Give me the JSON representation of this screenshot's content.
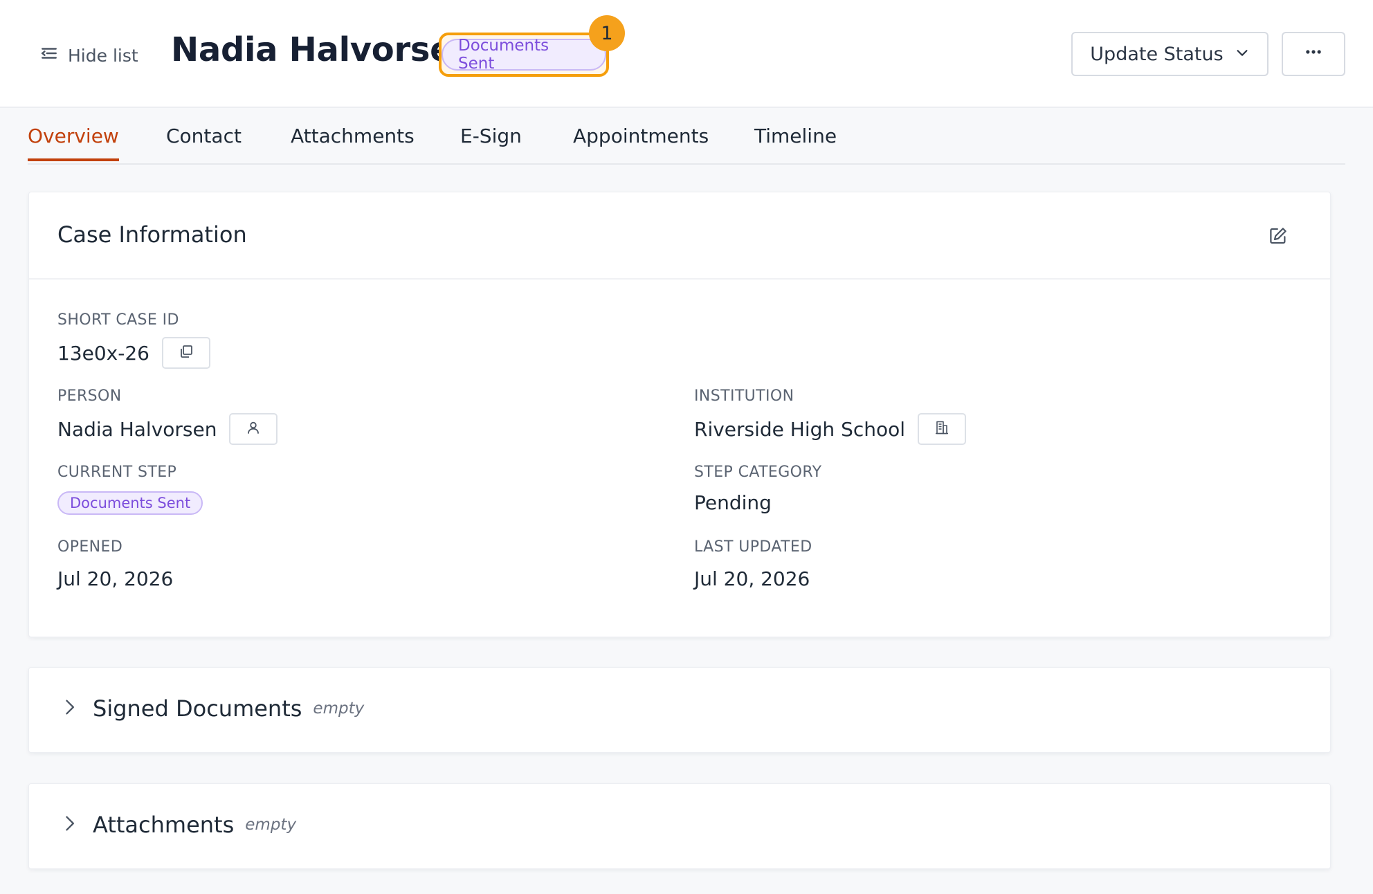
{
  "header": {
    "hide_list_label": "Hide list",
    "title": "Nadia Halvorsen",
    "status": "Documents Sent",
    "notification_count": "1",
    "update_status_label": "Update Status"
  },
  "tabs": [
    {
      "label": "Overview",
      "active": true
    },
    {
      "label": "Contact"
    },
    {
      "label": "Attachments"
    },
    {
      "label": "E-Sign"
    },
    {
      "label": "Appointments"
    },
    {
      "label": "Timeline"
    }
  ],
  "case_info": {
    "title": "Case Information",
    "short_case_id": {
      "label": "SHORT CASE ID",
      "value": "13e0x-26"
    },
    "person": {
      "label": "PERSON",
      "value": "Nadia Halvorsen"
    },
    "institution": {
      "label": "INSTITUTION",
      "value": "Riverside High School"
    },
    "current_step": {
      "label": "CURRENT STEP",
      "value": "Documents Sent"
    },
    "step_category": {
      "label": "STEP CATEGORY",
      "value": "Pending"
    },
    "opened": {
      "label": "OPENED",
      "value": "Jul 20, 2026"
    },
    "last_updated": {
      "label": "LAST UPDATED",
      "value": "Jul 20, 2026"
    }
  },
  "sections": [
    {
      "title": "Signed Documents",
      "state": "empty"
    },
    {
      "title": "Attachments",
      "state": "empty"
    }
  ],
  "colors": {
    "accent": "#c2410c",
    "highlight": "#f59e0b",
    "pill_bg": "#f1ecfe",
    "pill_text": "#7c4ddc"
  }
}
